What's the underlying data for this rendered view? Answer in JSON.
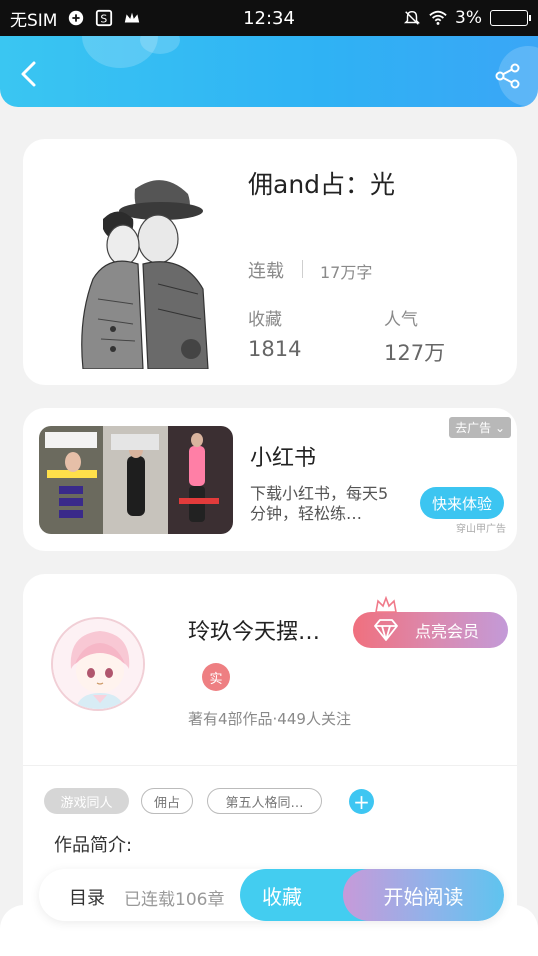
{
  "status_bar": {
    "carrier": "无SIM",
    "time": "12:34",
    "battery": "3%"
  },
  "header": {
    "back_icon": "chevron-left-icon",
    "share_icon": "share-icon"
  },
  "book": {
    "title": "佣and占：光",
    "status": "连载",
    "words": "17万字",
    "favorites_label": "收藏",
    "favorites_value": "1814",
    "popularity_label": "人气",
    "popularity_value": "127万"
  },
  "ad": {
    "title": "小红书",
    "description": "下载小红书，每天5分钟，轻松练…",
    "remove_ad": "去广告",
    "cta": "快来体验",
    "source": "穿山甲广告"
  },
  "author": {
    "name": "玲玖今天摆…",
    "real_badge": "实",
    "meta": "著有4部作品·449人关注",
    "vip_button": "点亮会员"
  },
  "tags": [
    "游戏同人",
    "佣占",
    "第五人格同…"
  ],
  "intro_label": "作品简介:",
  "bottom_bar": {
    "toc_label": "目录",
    "toc_count": "已连载106章",
    "collect": "收藏",
    "read": "开始阅读"
  },
  "colors": {
    "accent_blue": "#3cc5f1",
    "vip_pink": "#f0707e",
    "vip_purple": "#c39ad8"
  }
}
